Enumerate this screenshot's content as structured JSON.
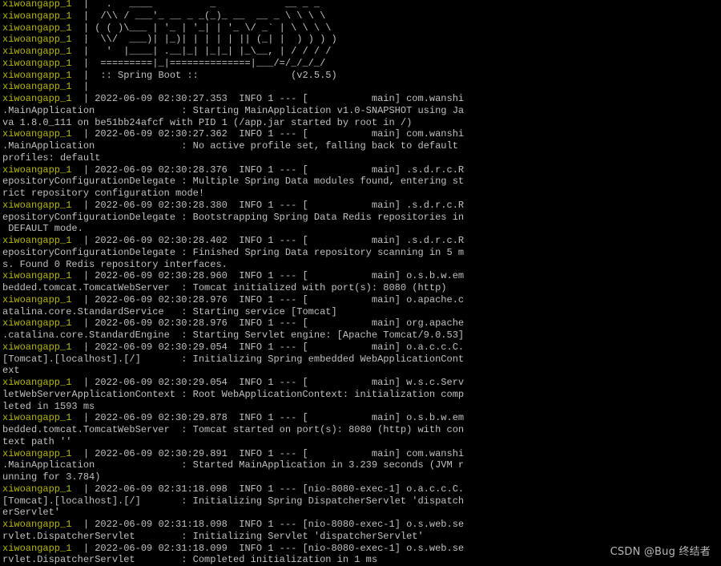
{
  "colors": {
    "background": "#000000",
    "prefix": "#b8b800",
    "text": "#c0c0c0",
    "watermark": "#b8b8b8"
  },
  "watermark": "CSDN @Bug 终结者",
  "lines": [
    {
      "prefix": "xiwoangapp_1",
      "text": "  |   .   ____          _            __ _ _"
    },
    {
      "prefix": "xiwoangapp_1",
      "text": "  |  /\\\\ / ___'_ __ _ _(_)_ __  __ _ \\ \\ \\ \\"
    },
    {
      "prefix": "xiwoangapp_1",
      "text": "  | ( ( )\\___ | '_ | '_| | '_ \\/ _` | \\ \\ \\ \\"
    },
    {
      "prefix": "xiwoangapp_1",
      "text": "  |  \\\\/  ___)| |_)| | | | | || (_| |  ) ) ) )"
    },
    {
      "prefix": "xiwoangapp_1",
      "text": "  |   '  |____| .__|_| |_|_| |_\\__, | / / / /"
    },
    {
      "prefix": "xiwoangapp_1",
      "text": "  |  =========|_|==============|___/=/_/_/_/"
    },
    {
      "prefix": "xiwoangapp_1",
      "text": "  |  :: Spring Boot ::                (v2.5.5)"
    },
    {
      "prefix": "xiwoangapp_1",
      "text": "  |"
    },
    {
      "prefix": "xiwoangapp_1",
      "text": "  | 2022-06-09 02:30:27.353  INFO 1 --- [           main] com.wanshi"
    },
    {
      "prefix": "",
      "text": ".MainApplication               : Starting MainApplication v1.0-SNAPSHOT using Ja"
    },
    {
      "prefix": "",
      "text": "va 1.8.0_111 on be51bb24afcf with PID 1 (/app.jar started by root in /)"
    },
    {
      "prefix": "xiwoangapp_1",
      "text": "  | 2022-06-09 02:30:27.362  INFO 1 --- [           main] com.wanshi"
    },
    {
      "prefix": "",
      "text": ".MainApplication               : No active profile set, falling back to default"
    },
    {
      "prefix": "",
      "text": "profiles: default"
    },
    {
      "prefix": "xiwoangapp_1",
      "text": "  | 2022-06-09 02:30:28.376  INFO 1 --- [           main] .s.d.r.c.R"
    },
    {
      "prefix": "",
      "text": "epositoryConfigurationDelegate : Multiple Spring Data modules found, entering st"
    },
    {
      "prefix": "",
      "text": "rict repository configuration mode!"
    },
    {
      "prefix": "xiwoangapp_1",
      "text": "  | 2022-06-09 02:30:28.380  INFO 1 --- [           main] .s.d.r.c.R"
    },
    {
      "prefix": "",
      "text": "epositoryConfigurationDelegate : Bootstrapping Spring Data Redis repositories in"
    },
    {
      "prefix": "",
      "text": " DEFAULT mode."
    },
    {
      "prefix": "xiwoangapp_1",
      "text": "  | 2022-06-09 02:30:28.402  INFO 1 --- [           main] .s.d.r.c.R"
    },
    {
      "prefix": "",
      "text": "epositoryConfigurationDelegate : Finished Spring Data repository scanning in 5 m"
    },
    {
      "prefix": "",
      "text": "s. Found 0 Redis repository interfaces."
    },
    {
      "prefix": "xiwoangapp_1",
      "text": "  | 2022-06-09 02:30:28.960  INFO 1 --- [           main] o.s.b.w.em"
    },
    {
      "prefix": "",
      "text": "bedded.tomcat.TomcatWebServer  : Tomcat initialized with port(s): 8080 (http)"
    },
    {
      "prefix": "xiwoangapp_1",
      "text": "  | 2022-06-09 02:30:28.976  INFO 1 --- [           main] o.apache.c"
    },
    {
      "prefix": "",
      "text": "atalina.core.StandardService   : Starting service [Tomcat]"
    },
    {
      "prefix": "xiwoangapp_1",
      "text": "  | 2022-06-09 02:30:28.976  INFO 1 --- [           main] org.apache"
    },
    {
      "prefix": "",
      "text": ".catalina.core.StandardEngine  : Starting Servlet engine: [Apache Tomcat/9.0.53]"
    },
    {
      "prefix": "xiwoangapp_1",
      "text": "  | 2022-06-09 02:30:29.054  INFO 1 --- [           main] o.a.c.c.C."
    },
    {
      "prefix": "",
      "text": "[Tomcat].[localhost].[/]       : Initializing Spring embedded WebApplicationCont"
    },
    {
      "prefix": "",
      "text": "ext"
    },
    {
      "prefix": "xiwoangapp_1",
      "text": "  | 2022-06-09 02:30:29.054  INFO 1 --- [           main] w.s.c.Serv"
    },
    {
      "prefix": "",
      "text": "letWebServerApplicationContext : Root WebApplicationContext: initialization comp"
    },
    {
      "prefix": "",
      "text": "leted in 1593 ms"
    },
    {
      "prefix": "xiwoangapp_1",
      "text": "  | 2022-06-09 02:30:29.878  INFO 1 --- [           main] o.s.b.w.em"
    },
    {
      "prefix": "",
      "text": "bedded.tomcat.TomcatWebServer  : Tomcat started on port(s): 8080 (http) with con"
    },
    {
      "prefix": "",
      "text": "text path ''"
    },
    {
      "prefix": "xiwoangapp_1",
      "text": "  | 2022-06-09 02:30:29.891  INFO 1 --- [           main] com.wanshi"
    },
    {
      "prefix": "",
      "text": ".MainApplication               : Started MainApplication in 3.239 seconds (JVM r"
    },
    {
      "prefix": "",
      "text": "unning for 3.784)"
    },
    {
      "prefix": "xiwoangapp_1",
      "text": "  | 2022-06-09 02:31:18.098  INFO 1 --- [nio-8080-exec-1] o.a.c.c.C."
    },
    {
      "prefix": "",
      "text": "[Tomcat].[localhost].[/]       : Initializing Spring DispatcherServlet 'dispatch"
    },
    {
      "prefix": "",
      "text": "erServlet'"
    },
    {
      "prefix": "xiwoangapp_1",
      "text": "  | 2022-06-09 02:31:18.098  INFO 1 --- [nio-8080-exec-1] o.s.web.se"
    },
    {
      "prefix": "",
      "text": "rvlet.DispatcherServlet        : Initializing Servlet 'dispatcherServlet'"
    },
    {
      "prefix": "xiwoangapp_1",
      "text": "  | 2022-06-09 02:31:18.099  INFO 1 --- [nio-8080-exec-1] o.s.web.se"
    },
    {
      "prefix": "",
      "text": "rvlet.DispatcherServlet        : Completed initialization in 1 ms"
    }
  ]
}
